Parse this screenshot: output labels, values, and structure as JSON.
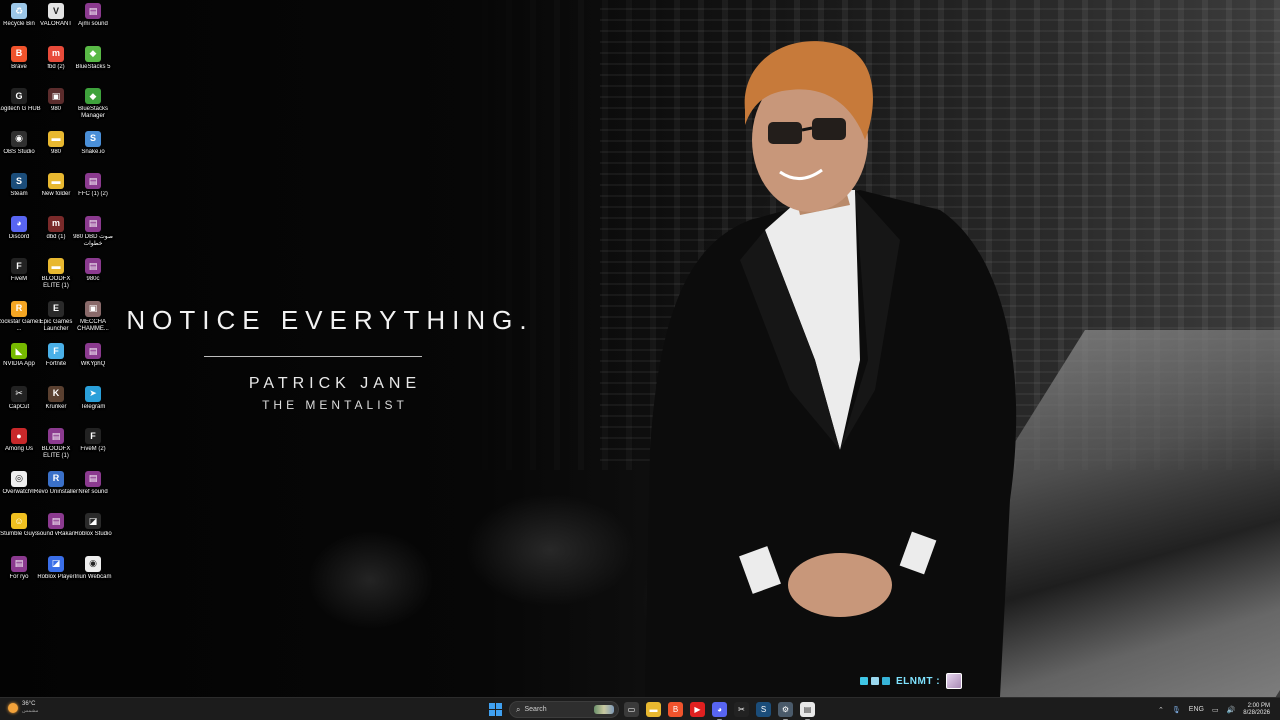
{
  "wallpaper": {
    "quote": "NOTICE EVERYTHING.",
    "name": "PATRICK JANE",
    "show": "THE MENTALIST"
  },
  "desktop_icons": [
    {
      "label": "Recycle Bin",
      "icon": "recycle-bin-icon",
      "color": "#9cc7e8",
      "glyph": "♻"
    },
    {
      "label": "VALORANT",
      "icon": "valorant-icon",
      "color": "#e3e3e3",
      "glyph": "V"
    },
    {
      "label": "Ajmi sound",
      "icon": "winrar-icon",
      "color": "#8b3a8f",
      "glyph": "▤"
    },
    {
      "label": "Brave",
      "icon": "brave-icon",
      "color": "#f0532c",
      "glyph": "B"
    },
    {
      "label": "fbd (2)",
      "icon": "fivem-icon",
      "color": "#e84b3a",
      "glyph": "m"
    },
    {
      "label": "BlueStacks 5",
      "icon": "bluestacks-icon",
      "color": "#59b946",
      "glyph": "◆"
    },
    {
      "label": "Logitech G HUB",
      "icon": "logitech-icon",
      "color": "#222222",
      "glyph": "G"
    },
    {
      "label": "980",
      "icon": "app-icon",
      "color": "#5b2c2c",
      "glyph": "▣"
    },
    {
      "label": "BlueStacks Manager",
      "icon": "bluestacks-manager-icon",
      "color": "#3ea23c",
      "glyph": "◆"
    },
    {
      "label": "OBS Studio",
      "icon": "obs-icon",
      "color": "#303030",
      "glyph": "◉"
    },
    {
      "label": "980",
      "icon": "folder-icon",
      "color": "#e8b830",
      "glyph": "▬"
    },
    {
      "label": "Snake.io",
      "icon": "snake-icon",
      "color": "#4a8fd8",
      "glyph": "S"
    },
    {
      "label": "Steam",
      "icon": "steam-icon",
      "color": "#1b4d7a",
      "glyph": "S"
    },
    {
      "label": "New folder",
      "icon": "folder-icon",
      "color": "#e8b830",
      "glyph": "▬"
    },
    {
      "label": "FFC (1) (2)",
      "icon": "winrar-icon",
      "color": "#8b3a8f",
      "glyph": "▤"
    },
    {
      "label": "Discord",
      "icon": "discord-icon",
      "color": "#5865f2",
      "glyph": "◕"
    },
    {
      "label": "dbd (1)",
      "icon": "fivem-icon",
      "color": "#7a2a2a",
      "glyph": "m"
    },
    {
      "label": "980 DBD صوت خطوات",
      "icon": "winrar-icon",
      "color": "#8b3a8f",
      "glyph": "▤"
    },
    {
      "label": "FiveM",
      "icon": "fivem-icon",
      "color": "#222222",
      "glyph": "F"
    },
    {
      "label": "BLOODFX ELITE (1)",
      "icon": "folder-icon",
      "color": "#e8b830",
      "glyph": "▬"
    },
    {
      "label": "980c",
      "icon": "winrar-icon",
      "color": "#8b3a8f",
      "glyph": "▤"
    },
    {
      "label": "Rockstar Games ...",
      "icon": "rockstar-icon",
      "color": "#f5a623",
      "glyph": "R"
    },
    {
      "label": "Epic Games Launcher",
      "icon": "epic-games-icon",
      "color": "#2a2a2a",
      "glyph": "E"
    },
    {
      "label": "MECCHA CHAMME...",
      "icon": "app-icon",
      "color": "#8a6a6a",
      "glyph": "▣"
    },
    {
      "label": "NVIDIA App",
      "icon": "nvidia-icon",
      "color": "#76b900",
      "glyph": "◣"
    },
    {
      "label": "Fortnite",
      "icon": "fortnite-icon",
      "color": "#4ab0e8",
      "glyph": "F"
    },
    {
      "label": "WKYphQ",
      "icon": "winrar-icon",
      "color": "#8b3a8f",
      "glyph": "▤"
    },
    {
      "label": "CapCut",
      "icon": "capcut-icon",
      "color": "#222222",
      "glyph": "✂"
    },
    {
      "label": "Krunker",
      "icon": "krunker-icon",
      "color": "#5a4030",
      "glyph": "K"
    },
    {
      "label": "Telegram",
      "icon": "telegram-icon",
      "color": "#2aa0da",
      "glyph": "➤"
    },
    {
      "label": "Among Us",
      "icon": "among-us-icon",
      "color": "#c8282a",
      "glyph": "●"
    },
    {
      "label": "BLOODFX ELITE (1)",
      "icon": "winrar-icon",
      "color": "#8b3a8f",
      "glyph": "▤"
    },
    {
      "label": "FiveM (2)",
      "icon": "fivem-icon",
      "color": "#222222",
      "glyph": "F"
    },
    {
      "label": "Overwatch®",
      "icon": "overwatch-icon",
      "color": "#eeeeee",
      "glyph": "◎"
    },
    {
      "label": "Revo Uninstaller",
      "icon": "revo-icon",
      "color": "#3a70c8",
      "glyph": "R"
    },
    {
      "label": "Nref sound",
      "icon": "winrar-icon",
      "color": "#8b3a8f",
      "glyph": "▤"
    },
    {
      "label": "Stumble Guys",
      "icon": "stumble-guys-icon",
      "color": "#f0c020",
      "glyph": "☺"
    },
    {
      "label": "sound vRakan",
      "icon": "winrar-icon",
      "color": "#8b3a8f",
      "glyph": "▤"
    },
    {
      "label": "Roblox Studio",
      "icon": "roblox-studio-icon",
      "color": "#2a2a2a",
      "glyph": "◪"
    },
    {
      "label": "For ryo",
      "icon": "winrar-icon",
      "color": "#8b3a8f",
      "glyph": "▤"
    },
    {
      "label": "Roblox Player",
      "icon": "roblox-icon",
      "color": "#3a6ee8",
      "glyph": "◪"
    },
    {
      "label": "Iriun Webcam",
      "icon": "iriun-webcam-icon",
      "color": "#eeeeee",
      "glyph": "◉"
    }
  ],
  "taskbar": {
    "weather_temp": "36°C",
    "weather_sub": "مشمس",
    "search_placeholder": "Search",
    "apps": [
      {
        "icon": "task-view-icon",
        "color": "#3a3a3a",
        "glyph": "▭",
        "active": false
      },
      {
        "icon": "file-explorer-icon",
        "color": "#e8b830",
        "glyph": "▬",
        "active": false
      },
      {
        "icon": "brave-icon",
        "color": "#f0532c",
        "glyph": "B",
        "active": false
      },
      {
        "icon": "youtube-icon",
        "color": "#e02020",
        "glyph": "▶",
        "active": false
      },
      {
        "icon": "discord-icon",
        "color": "#5865f2",
        "glyph": "◕",
        "active": true
      },
      {
        "icon": "capcut-icon",
        "color": "#222222",
        "glyph": "✂",
        "active": false
      },
      {
        "icon": "steam-icon",
        "color": "#1b4d7a",
        "glyph": "S",
        "active": false
      },
      {
        "icon": "settings-icon",
        "color": "#4a5a6a",
        "glyph": "⚙",
        "active": true
      },
      {
        "icon": "notepad-icon",
        "color": "#e8e8e8",
        "glyph": "▤",
        "active": true
      }
    ],
    "language": "ENG",
    "time": "2:00 PM",
    "date": "8/28/2026"
  },
  "overlay": {
    "name": "ELNMT :"
  }
}
